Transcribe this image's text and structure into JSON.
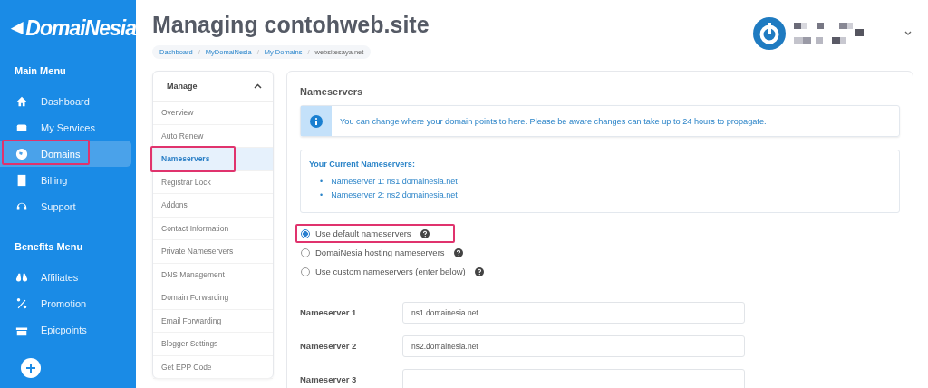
{
  "logo": {
    "text": "DomaiNesia"
  },
  "sidebar": {
    "sections": [
      {
        "heading": "Main Menu",
        "items": [
          {
            "label": "Dashboard",
            "selected": false,
            "highlighted": false
          },
          {
            "label": "My Services",
            "selected": false,
            "highlighted": false
          },
          {
            "label": "Domains",
            "selected": true,
            "highlighted": true
          },
          {
            "label": "Billing",
            "selected": false,
            "highlighted": false
          },
          {
            "label": "Support",
            "selected": false,
            "highlighted": false
          }
        ]
      },
      {
        "heading": "Benefits Menu",
        "items": [
          {
            "label": "Affiliates",
            "selected": false,
            "highlighted": false
          },
          {
            "label": "Promotion",
            "selected": false,
            "highlighted": false
          },
          {
            "label": "Epicpoints",
            "selected": false,
            "highlighted": false
          }
        ]
      }
    ]
  },
  "page": {
    "title": "Managing contohweb.site",
    "breadcrumb_separator": "/",
    "breadcrumb": [
      "Dashboard",
      "MyDomaiNesia",
      "My Domains",
      "websitesaya.net"
    ]
  },
  "manage_menu": {
    "title": "Manage",
    "expanded": true,
    "items": [
      {
        "label": "Overview",
        "selected": false,
        "highlighted": false
      },
      {
        "label": "Auto Renew",
        "selected": false,
        "highlighted": false
      },
      {
        "label": "Nameservers",
        "selected": true,
        "highlighted": true
      },
      {
        "label": "Registrar Lock",
        "selected": false,
        "highlighted": false
      },
      {
        "label": "Addons",
        "selected": false,
        "highlighted": false
      },
      {
        "label": "Contact Information",
        "selected": false,
        "highlighted": false
      },
      {
        "label": "Private Nameservers",
        "selected": false,
        "highlighted": false
      },
      {
        "label": "DNS Management",
        "selected": false,
        "highlighted": false
      },
      {
        "label": "Domain Forwarding",
        "selected": false,
        "highlighted": false
      },
      {
        "label": "Email Forwarding",
        "selected": false,
        "highlighted": false
      },
      {
        "label": "Blogger Settings",
        "selected": false,
        "highlighted": false
      },
      {
        "label": "Get EPP Code",
        "selected": false,
        "highlighted": false
      }
    ]
  },
  "nameservers": {
    "title": "Nameservers",
    "info": "You can change where your domain points to here. Please be aware changes can take up to 24 hours to propagate.",
    "current_title": "Your Current Nameservers:",
    "current": [
      {
        "bullet": "•",
        "text": "Nameserver 1: ns1.domainesia.net"
      },
      {
        "bullet": "•",
        "text": "Nameserver 2: ns2.domainesia.net"
      }
    ],
    "options": [
      {
        "label": "Use default nameservers",
        "selected": true,
        "highlighted": true
      },
      {
        "label": "DomaiNesia hosting nameservers",
        "selected": false,
        "highlighted": false
      },
      {
        "label": "Use custom nameservers (enter below)",
        "selected": false,
        "highlighted": false
      }
    ],
    "fields": [
      {
        "label": "Nameserver 1",
        "value": "ns1.domainesia.net"
      },
      {
        "label": "Nameserver 2",
        "value": "ns2.domainesia.net"
      },
      {
        "label": "Nameserver 3"
      }
    ]
  }
}
